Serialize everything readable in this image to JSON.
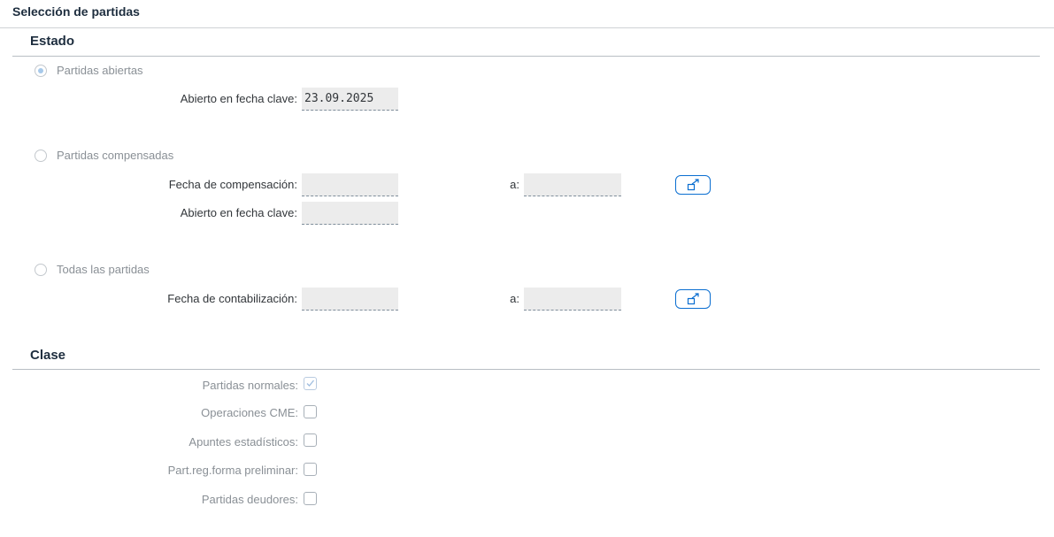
{
  "title": "Selección de partidas",
  "estado": {
    "heading": "Estado",
    "open_items": {
      "label": "Partidas abiertas",
      "key_date_label": "Abierto en fecha clave:",
      "key_date_value": "23.09.2025",
      "selected": true
    },
    "cleared_items": {
      "label": "Partidas compensadas",
      "clearing_date_label": "Fecha de compensación:",
      "to_label": "a:",
      "key_date_label": "Abierto en fecha clave:",
      "clearing_date_from": "",
      "clearing_date_to": "",
      "key_date_value": ""
    },
    "all_items": {
      "label": "Todas las partidas",
      "posting_date_label": "Fecha de contabilización:",
      "to_label": "a:",
      "posting_date_from": "",
      "posting_date_to": ""
    }
  },
  "clase": {
    "heading": "Clase",
    "checkboxes": [
      {
        "label": "Partidas normales:",
        "checked": true
      },
      {
        "label": "Operaciones CME:",
        "checked": false
      },
      {
        "label": "Apuntes estadísticos:",
        "checked": false
      },
      {
        "label": "Part.reg.forma preliminar:",
        "checked": false
      },
      {
        "label": "Partidas deudores:",
        "checked": false
      }
    ]
  },
  "icons": {
    "multiple_selection": "multiple-selection-icon",
    "checkmark": "checkmark-icon"
  },
  "colors": {
    "accent": "#0a6ed1",
    "input_bg": "#ececec",
    "disabled_text": "#8a9096"
  }
}
